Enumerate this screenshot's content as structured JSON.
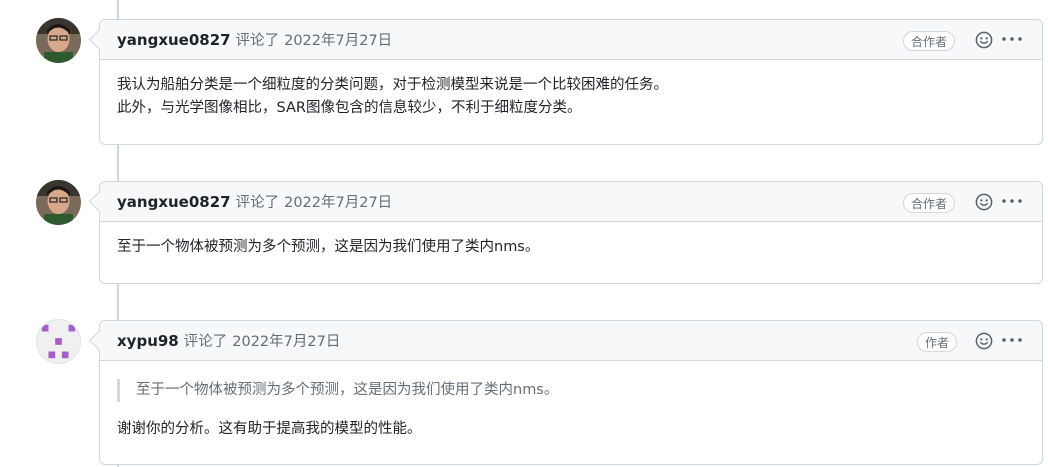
{
  "comments": [
    {
      "author": "yangxue0827",
      "action": "评论了",
      "date": "2022年7月27日",
      "badge": "合作者",
      "lines": [
        "我认为船舶分类是一个细粒度的分类问题，对于检测模型来说是一个比较困难的任务。",
        "此外，与光学图像相比，SAR图像包含的信息较少，不利于细粒度分类。"
      ]
    },
    {
      "author": "yangxue0827",
      "action": "评论了",
      "date": "2022年7月27日",
      "badge": "合作者",
      "lines": [
        "至于一个物体被预测为多个预测，这是因为我们使用了类内nms。"
      ]
    },
    {
      "author": "xypu98",
      "action": "评论了",
      "date": "2022年7月27日",
      "badge": "作者",
      "quote": "至于一个物体被预测为多个预测，这是因为我们使用了类内nms。",
      "lines": [
        "谢谢你的分析。这有助于提高我的模型的性能。"
      ]
    }
  ],
  "icons": {
    "reaction": "smiley-icon",
    "menu": "kebab-horizontal-icon"
  },
  "colors": {
    "border": "#d0d7de",
    "header_bg": "#f6f8fa",
    "muted_text": "#656d76",
    "identicon": "#a25ec9"
  }
}
